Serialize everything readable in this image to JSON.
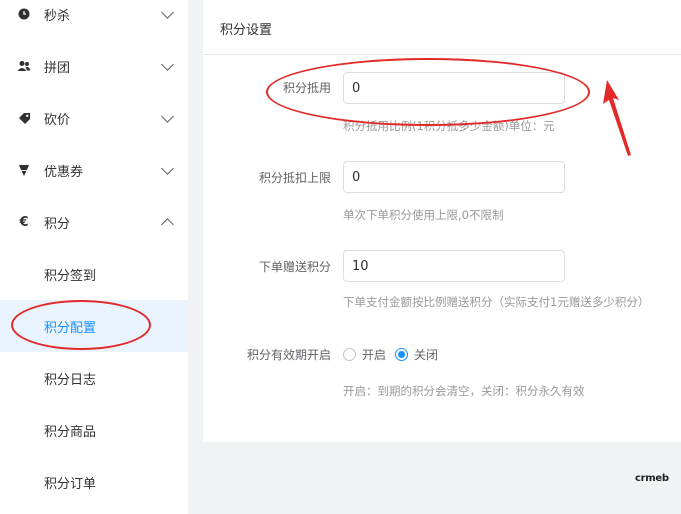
{
  "sidebar": {
    "items": [
      {
        "label": "秒杀",
        "icon": "clock-icon"
      },
      {
        "label": "拼团",
        "icon": "group-users-icon"
      },
      {
        "label": "砍价",
        "icon": "tag-icon"
      },
      {
        "label": "优惠券",
        "icon": "coupon-icon"
      },
      {
        "label": "积分",
        "icon": "euro-icon"
      }
    ],
    "sub_items": [
      {
        "label": "积分签到"
      },
      {
        "label": "积分配置"
      },
      {
        "label": "积分日志"
      },
      {
        "label": "积分商品"
      },
      {
        "label": "积分订单"
      }
    ],
    "active_sub": "积分配置"
  },
  "panel": {
    "title": "积分设置",
    "fields": [
      {
        "label": "积分抵用",
        "value": "0",
        "help": "积分抵用比例(1积分抵多少金额)单位：元"
      },
      {
        "label": "积分抵扣上限",
        "value": "0",
        "help": "单次下单积分使用上限,0不限制"
      },
      {
        "label": "下单赠送积分",
        "value": "10",
        "help": "下单支付金额按比例赠送积分（实际支付1元赠送多少积分）"
      }
    ],
    "expiry": {
      "label": "积分有效期开启",
      "options": [
        "开启",
        "关闭"
      ],
      "selected": "关闭",
      "help": "开启：到期的积分会清空，关闭：积分永久有效"
    }
  },
  "footer": {
    "logo": "crmeb"
  },
  "colors": {
    "accent": "#1890ff",
    "annotation": "#e22a2a",
    "active_bg": "#eaf4fe"
  }
}
